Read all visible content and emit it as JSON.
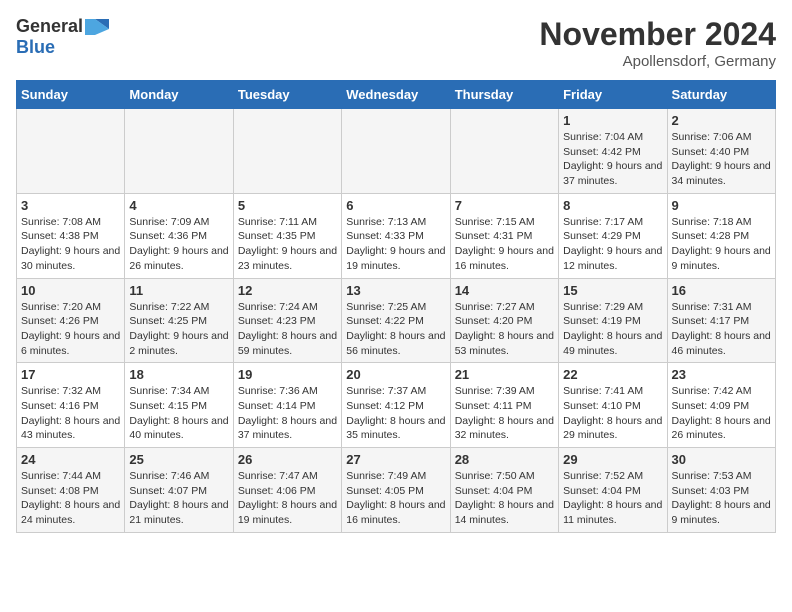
{
  "header": {
    "logo_general": "General",
    "logo_blue": "Blue",
    "month_title": "November 2024",
    "location": "Apollensdorf, Germany"
  },
  "days_of_week": [
    "Sunday",
    "Monday",
    "Tuesday",
    "Wednesday",
    "Thursday",
    "Friday",
    "Saturday"
  ],
  "weeks": [
    [
      {
        "day": "",
        "info": ""
      },
      {
        "day": "",
        "info": ""
      },
      {
        "day": "",
        "info": ""
      },
      {
        "day": "",
        "info": ""
      },
      {
        "day": "",
        "info": ""
      },
      {
        "day": "1",
        "info": "Sunrise: 7:04 AM\nSunset: 4:42 PM\nDaylight: 9 hours and 37 minutes."
      },
      {
        "day": "2",
        "info": "Sunrise: 7:06 AM\nSunset: 4:40 PM\nDaylight: 9 hours and 34 minutes."
      }
    ],
    [
      {
        "day": "3",
        "info": "Sunrise: 7:08 AM\nSunset: 4:38 PM\nDaylight: 9 hours and 30 minutes."
      },
      {
        "day": "4",
        "info": "Sunrise: 7:09 AM\nSunset: 4:36 PM\nDaylight: 9 hours and 26 minutes."
      },
      {
        "day": "5",
        "info": "Sunrise: 7:11 AM\nSunset: 4:35 PM\nDaylight: 9 hours and 23 minutes."
      },
      {
        "day": "6",
        "info": "Sunrise: 7:13 AM\nSunset: 4:33 PM\nDaylight: 9 hours and 19 minutes."
      },
      {
        "day": "7",
        "info": "Sunrise: 7:15 AM\nSunset: 4:31 PM\nDaylight: 9 hours and 16 minutes."
      },
      {
        "day": "8",
        "info": "Sunrise: 7:17 AM\nSunset: 4:29 PM\nDaylight: 9 hours and 12 minutes."
      },
      {
        "day": "9",
        "info": "Sunrise: 7:18 AM\nSunset: 4:28 PM\nDaylight: 9 hours and 9 minutes."
      }
    ],
    [
      {
        "day": "10",
        "info": "Sunrise: 7:20 AM\nSunset: 4:26 PM\nDaylight: 9 hours and 6 minutes."
      },
      {
        "day": "11",
        "info": "Sunrise: 7:22 AM\nSunset: 4:25 PM\nDaylight: 9 hours and 2 minutes."
      },
      {
        "day": "12",
        "info": "Sunrise: 7:24 AM\nSunset: 4:23 PM\nDaylight: 8 hours and 59 minutes."
      },
      {
        "day": "13",
        "info": "Sunrise: 7:25 AM\nSunset: 4:22 PM\nDaylight: 8 hours and 56 minutes."
      },
      {
        "day": "14",
        "info": "Sunrise: 7:27 AM\nSunset: 4:20 PM\nDaylight: 8 hours and 53 minutes."
      },
      {
        "day": "15",
        "info": "Sunrise: 7:29 AM\nSunset: 4:19 PM\nDaylight: 8 hours and 49 minutes."
      },
      {
        "day": "16",
        "info": "Sunrise: 7:31 AM\nSunset: 4:17 PM\nDaylight: 8 hours and 46 minutes."
      }
    ],
    [
      {
        "day": "17",
        "info": "Sunrise: 7:32 AM\nSunset: 4:16 PM\nDaylight: 8 hours and 43 minutes."
      },
      {
        "day": "18",
        "info": "Sunrise: 7:34 AM\nSunset: 4:15 PM\nDaylight: 8 hours and 40 minutes."
      },
      {
        "day": "19",
        "info": "Sunrise: 7:36 AM\nSunset: 4:14 PM\nDaylight: 8 hours and 37 minutes."
      },
      {
        "day": "20",
        "info": "Sunrise: 7:37 AM\nSunset: 4:12 PM\nDaylight: 8 hours and 35 minutes."
      },
      {
        "day": "21",
        "info": "Sunrise: 7:39 AM\nSunset: 4:11 PM\nDaylight: 8 hours and 32 minutes."
      },
      {
        "day": "22",
        "info": "Sunrise: 7:41 AM\nSunset: 4:10 PM\nDaylight: 8 hours and 29 minutes."
      },
      {
        "day": "23",
        "info": "Sunrise: 7:42 AM\nSunset: 4:09 PM\nDaylight: 8 hours and 26 minutes."
      }
    ],
    [
      {
        "day": "24",
        "info": "Sunrise: 7:44 AM\nSunset: 4:08 PM\nDaylight: 8 hours and 24 minutes."
      },
      {
        "day": "25",
        "info": "Sunrise: 7:46 AM\nSunset: 4:07 PM\nDaylight: 8 hours and 21 minutes."
      },
      {
        "day": "26",
        "info": "Sunrise: 7:47 AM\nSunset: 4:06 PM\nDaylight: 8 hours and 19 minutes."
      },
      {
        "day": "27",
        "info": "Sunrise: 7:49 AM\nSunset: 4:05 PM\nDaylight: 8 hours and 16 minutes."
      },
      {
        "day": "28",
        "info": "Sunrise: 7:50 AM\nSunset: 4:04 PM\nDaylight: 8 hours and 14 minutes."
      },
      {
        "day": "29",
        "info": "Sunrise: 7:52 AM\nSunset: 4:04 PM\nDaylight: 8 hours and 11 minutes."
      },
      {
        "day": "30",
        "info": "Sunrise: 7:53 AM\nSunset: 4:03 PM\nDaylight: 8 hours and 9 minutes."
      }
    ]
  ]
}
